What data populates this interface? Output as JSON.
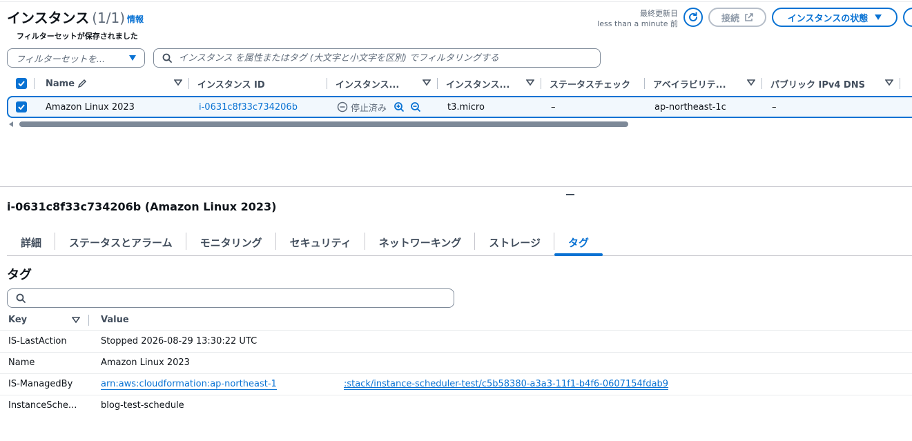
{
  "header": {
    "title": "インスタンス",
    "count": "(1/1)",
    "info_link": "情報",
    "last_updated_label": "最終更新日",
    "last_updated_value": "less than a minute 前",
    "connect_label": "接続",
    "instance_state_label": "インスタンスの状態"
  },
  "filters": {
    "saved_set_label": "フィルターセットが保存されました",
    "saved_set_placeholder": "フィルターセットを...",
    "search_placeholder": "インスタンス を属性またはタグ (大文字と小文字を区別) でフィルタリングする"
  },
  "table": {
    "columns": [
      "Name",
      "インスタンス ID",
      "インスタンス...",
      "インスタンス...",
      "ステータスチェック",
      "アベイラビリテ...",
      "パブリック IPv4 DNS"
    ],
    "rows": [
      {
        "name": "Amazon Linux 2023",
        "instance_id": "i-0631c8f33c734206b",
        "state": "停止済み",
        "type": "t3.micro",
        "status_check": "–",
        "az": "ap-northeast-1c",
        "public_dns": "–"
      }
    ]
  },
  "details": {
    "title": "i-0631c8f33c734206b (Amazon Linux 2023)",
    "tabs": [
      "詳細",
      "ステータスとアラーム",
      "モニタリング",
      "セキュリティ",
      "ネットワーキング",
      "ストレージ",
      "タグ"
    ],
    "active_tab": "タグ"
  },
  "tags": {
    "title": "タグ",
    "search_placeholder": "",
    "key_header": "Key",
    "value_header": "Value",
    "rows": [
      {
        "key": "IS-LastAction",
        "value": "Stopped 2026-08-29 13:30:22 UTC"
      },
      {
        "key": "Name",
        "value": "Amazon Linux 2023"
      },
      {
        "key": "IS-ManagedBy",
        "value": "arn:aws:cloudformation:ap-northeast-1",
        "value_cont": ":stack/instance-scheduler-test/c5b58380-a3a3-11f1-b4f6-0607154fdab9"
      },
      {
        "key": "InstanceSche...",
        "value": "blog-test-schedule"
      }
    ]
  },
  "colors": {
    "accent": "#0972d3",
    "text": "#0f141a",
    "muted": "#5f6b7a",
    "selected_row_bg": "#f2f8fd"
  }
}
